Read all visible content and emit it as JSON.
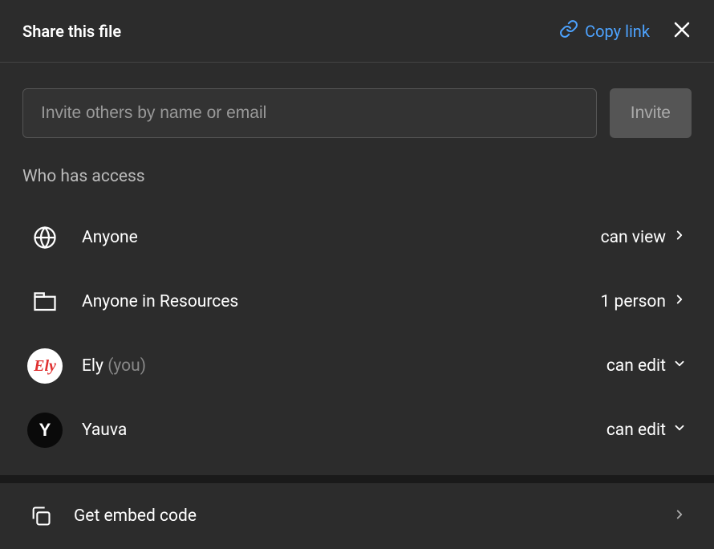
{
  "header": {
    "title": "Share this file",
    "copy_link_label": "Copy link"
  },
  "invite": {
    "placeholder": "Invite others by name or email",
    "button_label": "Invite"
  },
  "section_label": "Who has access",
  "access_list": [
    {
      "icon": "globe",
      "label": "Anyone",
      "permission": "can view",
      "chevron": "right"
    },
    {
      "icon": "folder",
      "label": "Anyone in Resources",
      "permission": "1 person",
      "chevron": "right"
    },
    {
      "icon": "avatar-ely",
      "label": "Ely",
      "you_label": "(you)",
      "permission": "can edit",
      "chevron": "down"
    },
    {
      "icon": "avatar-yauva",
      "label": "Yauva",
      "permission": "can edit",
      "chevron": "down"
    }
  ],
  "footer": {
    "label": "Get embed code"
  }
}
